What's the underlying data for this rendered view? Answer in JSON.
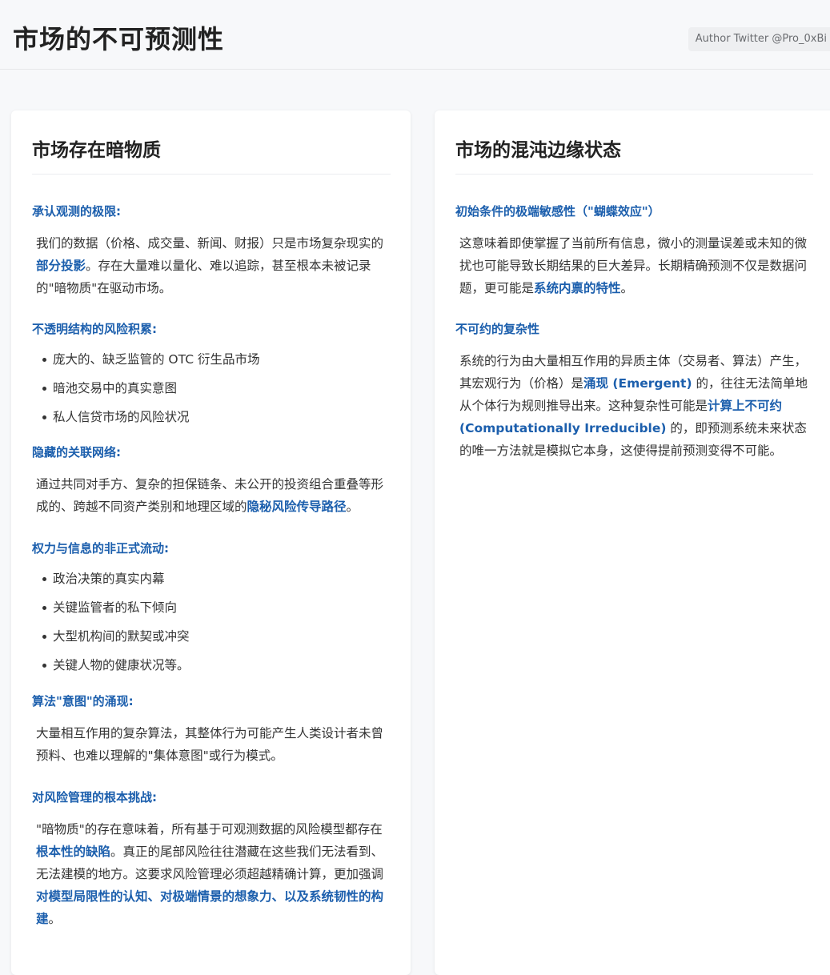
{
  "header": {
    "title": "市场的不可预测性",
    "author": "Author Twitter @Pro_0xBi"
  },
  "left": {
    "title": "市场存在暗物质",
    "s1": {
      "heading": "承认观测的极限:",
      "t1": "我们的数据（价格、成交量、新闻、财报）只是市场复杂现实的",
      "h1": "部分投影",
      "t2": "。存在大量难以量化、难以追踪，甚至根本未被记录的\"暗物质\"在驱动市场。"
    },
    "s2": {
      "heading": "不透明结构的风险积累:",
      "items": [
        "庞大的、缺乏监管的 OTC 衍生品市场",
        "暗池交易中的真实意图",
        "私人信贷市场的风险状况"
      ]
    },
    "s3": {
      "heading": "隐藏的关联网络:",
      "t1": "通过共同对手方、复杂的担保链条、未公开的投资组合重叠等形成的、跨越不同资产类别和地理区域的",
      "h1": "隐秘风险传导路径",
      "t2": "。"
    },
    "s4": {
      "heading": "权力与信息的非正式流动:",
      "items": [
        "政治决策的真实内幕",
        "关键监管者的私下倾向",
        "大型机构间的默契或冲突",
        "关键人物的健康状况等。"
      ]
    },
    "s5": {
      "heading": "算法\"意图\"的涌现:",
      "t1": "大量相互作用的复杂算法，其整体行为可能产生人类设计者未曾预料、也难以理解的\"集体意图\"或行为模式。"
    },
    "s6": {
      "heading": "对风险管理的根本挑战:",
      "t1": "\"暗物质\"的存在意味着，所有基于可观测数据的风险模型都存在",
      "h1": "根本性的缺陷",
      "t2": "。真正的尾部风险往往潜藏在这些我们无法看到、无法建模的地方。这要求风险管理必须超越精确计算，更加强调",
      "h2": "对模型局限性的认知、对极端情景的想象力、以及系统韧性的构建",
      "t3": "。"
    }
  },
  "right": {
    "title": "市场的混沌边缘状态",
    "s1": {
      "heading": "初始条件的极端敏感性（\"蝴蝶效应\"）",
      "t1": "这意味着即使掌握了当前所有信息，微小的测量误差或未知的微扰也可能导致长期结果的巨大差异。长期精确预测不仅是数据问题，更可能是",
      "h1": "系统内禀的特性",
      "t2": "。"
    },
    "s2": {
      "heading": "不可约的复杂性",
      "t1": "系统的行为由大量相互作用的异质主体（交易者、算法）产生，其宏观行为（价格）是",
      "h1": "涌现 (Emergent)",
      "t2": " 的，往往无法简单地从个体行为规则推导出来。这种复杂性可能是",
      "h2": "计算上不可约 (Computationally Irreducible)",
      "t3": " 的，即预测系统未来状态的唯一方法就是模拟它本身，这使得提前预测变得不可能。"
    }
  }
}
